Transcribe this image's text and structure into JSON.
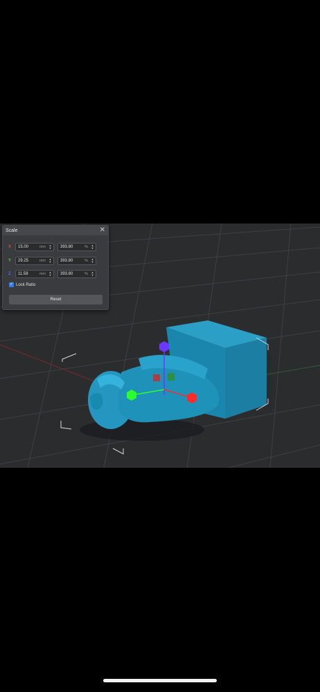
{
  "panel": {
    "title": "Scale",
    "close_glyph": "✕",
    "rows": [
      {
        "axis": "X",
        "axis_color": "#e04545",
        "value": "15.00",
        "unit": "mm",
        "percent": "393.80",
        "percent_unit": "%"
      },
      {
        "axis": "Y",
        "axis_color": "#45d045",
        "value": "29.25",
        "unit": "mm",
        "percent": "393.80",
        "percent_unit": "%"
      },
      {
        "axis": "Z",
        "axis_color": "#4a6cff",
        "value": "11.58",
        "unit": "mm",
        "percent": "393.80",
        "percent_unit": "%"
      }
    ],
    "lock_ratio_label": "Lock Ratio",
    "lock_ratio_checked": true,
    "reset_label": "Reset"
  },
  "scene": {
    "model_color": "#1d8fb5",
    "gizmo": {
      "x_color": "#ff2a2a",
      "y_color": "#2bff2b",
      "z_color": "#6a38ff"
    },
    "icons": [
      "scale-gizmo",
      "bounding-box-corners",
      "grid-floor"
    ]
  }
}
